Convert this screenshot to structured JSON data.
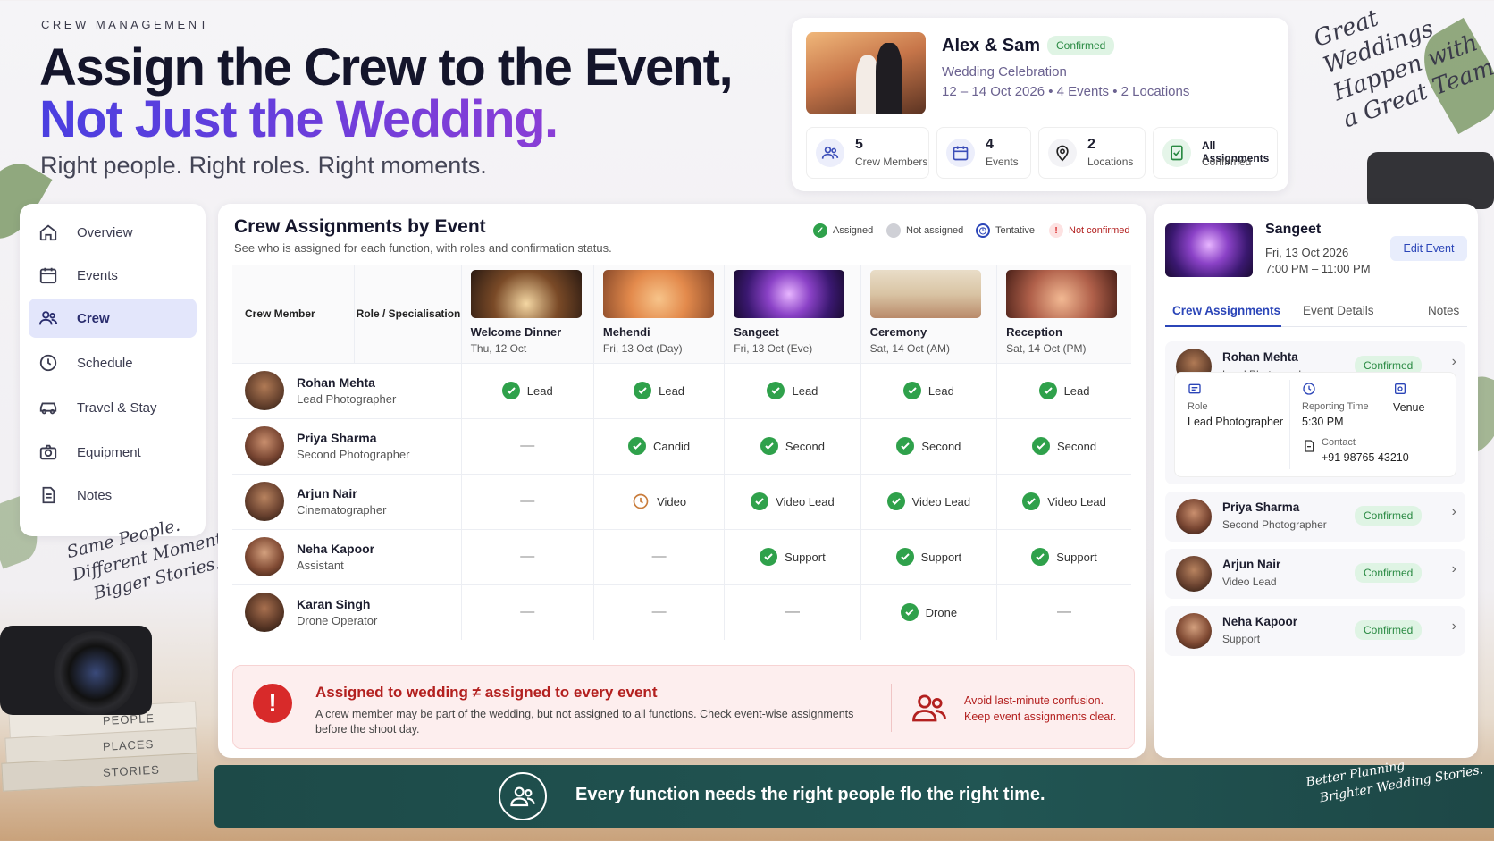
{
  "header": {
    "eyebrow": "CREW MANAGEMENT",
    "title_line1": "Assign the Crew to the Event,",
    "title_line2": "Not Just the Wedding.",
    "tagline": "Right people. Right roles. Right moments."
  },
  "couple_card": {
    "name": "Alex & Sam",
    "status": "Confirmed",
    "subtitle": "Wedding Celebration",
    "meta": "12 – 14 Oct 2026  •  4 Events  •  2 Locations",
    "stats": [
      {
        "icon": "people-icon",
        "value": "5",
        "label": "Crew Members"
      },
      {
        "icon": "calendar-icon",
        "value": "4",
        "label": "Events"
      },
      {
        "icon": "location-pin-icon",
        "value": "2",
        "label": "Locations"
      },
      {
        "icon": "document-check-icon",
        "value": "All Assignments",
        "label": "Confirmed"
      }
    ]
  },
  "handwriting": {
    "top_right": [
      "Great",
      "Weddings",
      "Happen with",
      "a Great Team"
    ],
    "left": [
      "Same People.",
      "Different Moments.",
      "Bigger Stories."
    ],
    "books": [
      "PEOPLE",
      "PLACES",
      "STORIES"
    ],
    "bottom_right": [
      "Better Planning",
      "Brighter Wedding Stories."
    ]
  },
  "sidebar": {
    "items": [
      {
        "label": "Overview",
        "icon": "home-icon"
      },
      {
        "label": "Events",
        "icon": "calendar-icon"
      },
      {
        "label": "Crew",
        "icon": "people-icon",
        "active": true
      },
      {
        "label": "Schedule",
        "icon": "clock-icon"
      },
      {
        "label": "Travel & Stay",
        "icon": "car-icon"
      },
      {
        "label": "Equipment",
        "icon": "camera-icon"
      },
      {
        "label": "Notes",
        "icon": "notes-icon"
      }
    ]
  },
  "assignments": {
    "title": "Crew Assignments by Event",
    "subtitle": "See who is assigned for each function, with roles and confirmation status.",
    "legend": {
      "assigned": "Assigned",
      "not_assigned": "Not assigned",
      "tentative": "Tentative",
      "not_confirmed": "Not confirmed"
    },
    "col_member": "Crew Member",
    "col_role": "Role / Specialisation",
    "events": [
      {
        "name": "Welcome Dinner",
        "date": "Thu, 12 Oct"
      },
      {
        "name": "Mehendi",
        "date": "Fri, 13 Oct (Day)"
      },
      {
        "name": "Sangeet",
        "date": "Fri, 13 Oct (Eve)"
      },
      {
        "name": "Ceremony",
        "date": "Sat, 14 Oct (AM)"
      },
      {
        "name": "Reception",
        "date": "Sat, 14 Oct (PM)"
      }
    ],
    "rows": [
      {
        "name": "Rohan Mehta",
        "role": "Lead Photographer",
        "cells": [
          {
            "s": "assigned",
            "t": "Lead"
          },
          {
            "s": "assigned",
            "t": "Lead"
          },
          {
            "s": "assigned",
            "t": "Lead"
          },
          {
            "s": "assigned",
            "t": "Lead"
          },
          {
            "s": "assigned",
            "t": "Lead"
          }
        ]
      },
      {
        "name": "Priya Sharma",
        "role": "Second Photographer",
        "cells": [
          {
            "s": "none",
            "t": "—"
          },
          {
            "s": "assigned",
            "t": "Candid"
          },
          {
            "s": "assigned",
            "t": "Second"
          },
          {
            "s": "assigned",
            "t": "Second"
          },
          {
            "s": "assigned",
            "t": "Second"
          }
        ]
      },
      {
        "name": "Arjun Nair",
        "role": "Cinematographer",
        "cells": [
          {
            "s": "none",
            "t": "—"
          },
          {
            "s": "tentative",
            "t": "Video"
          },
          {
            "s": "assigned",
            "t": "Video Lead"
          },
          {
            "s": "assigned",
            "t": "Video Lead"
          },
          {
            "s": "assigned",
            "t": "Video Lead"
          }
        ]
      },
      {
        "name": "Neha Kapoor",
        "role": "Assistant",
        "cells": [
          {
            "s": "none",
            "t": "—"
          },
          {
            "s": "none",
            "t": "—"
          },
          {
            "s": "assigned",
            "t": "Support"
          },
          {
            "s": "assigned",
            "t": "Support"
          },
          {
            "s": "assigned",
            "t": "Support"
          }
        ]
      },
      {
        "name": "Karan Singh",
        "role": "Drone Operator",
        "cells": [
          {
            "s": "none",
            "t": "—"
          },
          {
            "s": "none",
            "t": "—"
          },
          {
            "s": "none",
            "t": "—"
          },
          {
            "s": "assigned",
            "t": "Drone"
          },
          {
            "s": "none",
            "t": "—"
          }
        ]
      }
    ]
  },
  "alert": {
    "title": "Assigned to wedding ≠ assigned to every event",
    "body": "A crew member may be part of the wedding, but not assigned to all functions. Check event-wise assignments before the shoot day.",
    "side_line1": "Avoid last-minute confusion.",
    "side_line2": "Keep event assignments clear."
  },
  "detail": {
    "title": "Sangeet",
    "date": "Fri, 13 Oct 2026",
    "time": "7:00 PM – 11:00 PM",
    "edit": "Edit Event",
    "tabs": [
      "Crew Assignments",
      "Event Details",
      "Notes"
    ],
    "expanded": {
      "name": "Rohan Mehta",
      "role": "Lead Photographer",
      "status": "Confirmed",
      "role_label": "Role",
      "role_value": "Lead Photographer",
      "reporting_label": "Reporting Time",
      "reporting_value": "5:30 PM",
      "venue_label": "Venue",
      "contact_label": "Contact",
      "contact_value": "+91 98765 43210"
    },
    "people": [
      {
        "name": "Priya Sharma",
        "role": "Second Photographer",
        "status": "Confirmed"
      },
      {
        "name": "Arjun Nair",
        "role": "Video Lead",
        "status": "Confirmed"
      },
      {
        "name": "Neha Kapoor",
        "role": "Support",
        "status": "Confirmed"
      }
    ]
  },
  "footer": {
    "text": "Every function needs the right people flo the right time."
  },
  "colors": {
    "accent": "#2b45b8",
    "assigned": "#2fa14b",
    "alert": "#d82a2a",
    "footer": "#1d4a48",
    "title_gradient": [
      "#4a3fe0",
      "#8a3ed6"
    ]
  }
}
